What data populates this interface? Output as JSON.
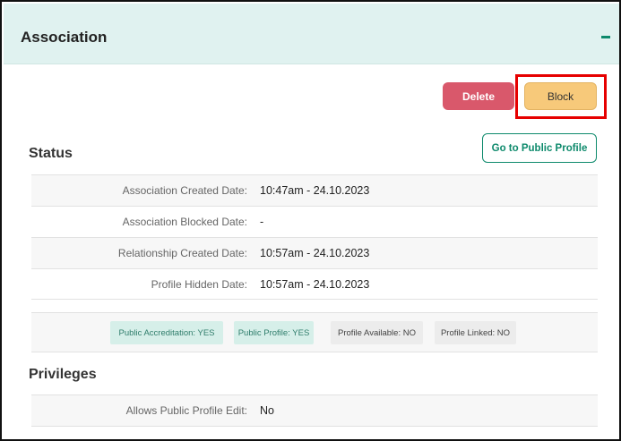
{
  "panel": {
    "title": "Association"
  },
  "actions": {
    "delete_label": "Delete",
    "block_label": "Block",
    "public_profile_label": "Go to Public Profile"
  },
  "status": {
    "title": "Status",
    "rows": [
      {
        "label": "Association Created Date:",
        "value": "10:47am - 24.10.2023"
      },
      {
        "label": "Association Blocked Date:",
        "value": "-"
      },
      {
        "label": "Relationship Created Date:",
        "value": "10:57am - 24.10.2023"
      },
      {
        "label": "Profile Hidden Date:",
        "value": "10:57am - 24.10.2023"
      }
    ],
    "badges": [
      {
        "label": "Public Accreditation: YES",
        "state": "yes"
      },
      {
        "label": "Public Profile: YES",
        "state": "yes"
      },
      {
        "label": "Profile Available: NO",
        "state": "no"
      },
      {
        "label": "Profile Linked: NO",
        "state": "no"
      }
    ]
  },
  "privileges": {
    "title": "Privileges",
    "rows": [
      {
        "label": "Allows Public Profile Edit:",
        "value": "No"
      }
    ]
  },
  "colors": {
    "header_bg": "#e0f2f0",
    "accent": "#0e8a6c",
    "delete": "#d9586b",
    "block": "#f7c97a",
    "highlight": "#e60000"
  },
  "icons": {
    "collapse": "minus-icon"
  }
}
